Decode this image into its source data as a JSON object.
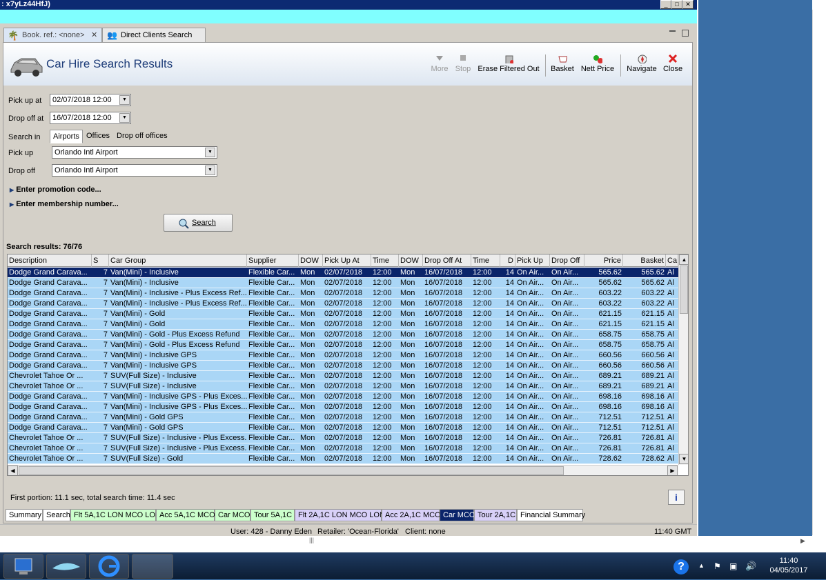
{
  "window": {
    "title": ": x7yLz44HfJ)"
  },
  "doc_tabs": [
    {
      "label": "Book. ref.: <none>"
    },
    {
      "label": "Direct Clients Search"
    }
  ],
  "header": {
    "title": "Car Hire Search Results"
  },
  "toolbar": {
    "more": "More",
    "stop": "Stop",
    "erase": "Erase Filtered Out",
    "basket": "Basket",
    "nett_price": "Nett Price",
    "navigate": "Navigate",
    "close": "Close"
  },
  "form": {
    "pickup_at_label": "Pick up at",
    "pickup_at_value": "02/07/2018 12:00",
    "dropoff_at_label": "Drop off at",
    "dropoff_at_value": "16/07/2018 12:00",
    "search_in_label": "Search in",
    "search_in_options": [
      "Airports",
      "Offices",
      "Drop off offices"
    ],
    "pickup_label": "Pick up",
    "pickup_value": "Orlando Intl Airport",
    "dropoff_label": "Drop off",
    "dropoff_value": "Orlando Intl Airport",
    "promo": "Enter promotion code...",
    "membership": "Enter membership number...",
    "search_button": "Search"
  },
  "results": {
    "label": "Search results: 76/76",
    "columns": [
      "Description",
      "S",
      "Car Group",
      "Supplier",
      "DOW",
      "Pick Up At",
      "Time",
      "DOW",
      "Drop Off At",
      "Time",
      "D",
      "Pick Up",
      "Drop Off",
      "Price",
      "Basket",
      "Ca"
    ],
    "rows": [
      [
        "Dodge Grand Carava...",
        "7",
        "Van(Mini) - Inclusive",
        "Flexible Car...",
        "Mon",
        "02/07/2018",
        "12:00",
        "Mon",
        "16/07/2018",
        "12:00",
        "14",
        "On Air...",
        "On Air...",
        "565.62",
        "565.62",
        "Al"
      ],
      [
        "Dodge Grand Carava...",
        "7",
        "Van(Mini) - Inclusive",
        "Flexible Car...",
        "Mon",
        "02/07/2018",
        "12:00",
        "Mon",
        "16/07/2018",
        "12:00",
        "14",
        "On Air...",
        "On Air...",
        "565.62",
        "565.62",
        "Al"
      ],
      [
        "Dodge Grand Carava...",
        "7",
        "Van(Mini) - Inclusive - Plus Excess Ref...",
        "Flexible Car...",
        "Mon",
        "02/07/2018",
        "12:00",
        "Mon",
        "16/07/2018",
        "12:00",
        "14",
        "On Air...",
        "On Air...",
        "603.22",
        "603.22",
        "Al"
      ],
      [
        "Dodge Grand Carava...",
        "7",
        "Van(Mini) - Inclusive - Plus Excess Ref...",
        "Flexible Car...",
        "Mon",
        "02/07/2018",
        "12:00",
        "Mon",
        "16/07/2018",
        "12:00",
        "14",
        "On Air...",
        "On Air...",
        "603.22",
        "603.22",
        "Al"
      ],
      [
        "Dodge Grand Carava...",
        "7",
        "Van(Mini) - Gold",
        "Flexible Car...",
        "Mon",
        "02/07/2018",
        "12:00",
        "Mon",
        "16/07/2018",
        "12:00",
        "14",
        "On Air...",
        "On Air...",
        "621.15",
        "621.15",
        "Al"
      ],
      [
        "Dodge Grand Carava...",
        "7",
        "Van(Mini) - Gold",
        "Flexible Car...",
        "Mon",
        "02/07/2018",
        "12:00",
        "Mon",
        "16/07/2018",
        "12:00",
        "14",
        "On Air...",
        "On Air...",
        "621.15",
        "621.15",
        "Al"
      ],
      [
        "Dodge Grand Carava...",
        "7",
        "Van(Mini) - Gold - Plus Excess Refund",
        "Flexible Car...",
        "Mon",
        "02/07/2018",
        "12:00",
        "Mon",
        "16/07/2018",
        "12:00",
        "14",
        "On Air...",
        "On Air...",
        "658.75",
        "658.75",
        "Al"
      ],
      [
        "Dodge Grand Carava...",
        "7",
        "Van(Mini) - Gold - Plus Excess Refund",
        "Flexible Car...",
        "Mon",
        "02/07/2018",
        "12:00",
        "Mon",
        "16/07/2018",
        "12:00",
        "14",
        "On Air...",
        "On Air...",
        "658.75",
        "658.75",
        "Al"
      ],
      [
        "Dodge Grand Carava...",
        "7",
        "Van(Mini) - Inclusive GPS",
        "Flexible Car...",
        "Mon",
        "02/07/2018",
        "12:00",
        "Mon",
        "16/07/2018",
        "12:00",
        "14",
        "On Air...",
        "On Air...",
        "660.56",
        "660.56",
        "Al"
      ],
      [
        "Dodge Grand Carava...",
        "7",
        "Van(Mini) - Inclusive GPS",
        "Flexible Car...",
        "Mon",
        "02/07/2018",
        "12:00",
        "Mon",
        "16/07/2018",
        "12:00",
        "14",
        "On Air...",
        "On Air...",
        "660.56",
        "660.56",
        "Al"
      ],
      [
        "Chevrolet Tahoe Or ...",
        "7",
        "SUV(Full Size) - Inclusive",
        "Flexible Car...",
        "Mon",
        "02/07/2018",
        "12:00",
        "Mon",
        "16/07/2018",
        "12:00",
        "14",
        "On Air...",
        "On Air...",
        "689.21",
        "689.21",
        "Al"
      ],
      [
        "Chevrolet Tahoe Or ...",
        "7",
        "SUV(Full Size) - Inclusive",
        "Flexible Car...",
        "Mon",
        "02/07/2018",
        "12:00",
        "Mon",
        "16/07/2018",
        "12:00",
        "14",
        "On Air...",
        "On Air...",
        "689.21",
        "689.21",
        "Al"
      ],
      [
        "Dodge Grand Carava...",
        "7",
        "Van(Mini) - Inclusive GPS - Plus Exces...",
        "Flexible Car...",
        "Mon",
        "02/07/2018",
        "12:00",
        "Mon",
        "16/07/2018",
        "12:00",
        "14",
        "On Air...",
        "On Air...",
        "698.16",
        "698.16",
        "Al"
      ],
      [
        "Dodge Grand Carava...",
        "7",
        "Van(Mini) - Inclusive GPS - Plus Exces...",
        "Flexible Car...",
        "Mon",
        "02/07/2018",
        "12:00",
        "Mon",
        "16/07/2018",
        "12:00",
        "14",
        "On Air...",
        "On Air...",
        "698.16",
        "698.16",
        "Al"
      ],
      [
        "Dodge Grand Carava...",
        "7",
        "Van(Mini) - Gold GPS",
        "Flexible Car...",
        "Mon",
        "02/07/2018",
        "12:00",
        "Mon",
        "16/07/2018",
        "12:00",
        "14",
        "On Air...",
        "On Air...",
        "712.51",
        "712.51",
        "Al"
      ],
      [
        "Dodge Grand Carava...",
        "7",
        "Van(Mini) - Gold GPS",
        "Flexible Car...",
        "Mon",
        "02/07/2018",
        "12:00",
        "Mon",
        "16/07/2018",
        "12:00",
        "14",
        "On Air...",
        "On Air...",
        "712.51",
        "712.51",
        "Al"
      ],
      [
        "Chevrolet Tahoe Or ...",
        "7",
        "SUV(Full Size) - Inclusive - Plus Excess...",
        "Flexible Car...",
        "Mon",
        "02/07/2018",
        "12:00",
        "Mon",
        "16/07/2018",
        "12:00",
        "14",
        "On Air...",
        "On Air...",
        "726.81",
        "726.81",
        "Al"
      ],
      [
        "Chevrolet Tahoe Or ...",
        "7",
        "SUV(Full Size) - Inclusive - Plus Excess...",
        "Flexible Car...",
        "Mon",
        "02/07/2018",
        "12:00",
        "Mon",
        "16/07/2018",
        "12:00",
        "14",
        "On Air...",
        "On Air...",
        "726.81",
        "726.81",
        "Al"
      ],
      [
        "Chevrolet Tahoe Or ...",
        "7",
        "SUV(Full Size) - Gold",
        "Flexible Car...",
        "Mon",
        "02/07/2018",
        "12:00",
        "Mon",
        "16/07/2018",
        "12:00",
        "14",
        "On Air...",
        "On Air...",
        "728.62",
        "728.62",
        "Al"
      ]
    ]
  },
  "timing": "First portion: 11.1 sec, total search time: 11.4 sec",
  "bottom_tabs": [
    {
      "label": "Summary",
      "color": "#ffffff"
    },
    {
      "label": "Search",
      "color": "#ffffff"
    },
    {
      "label": "Flt 5A,1C LON MCO LON",
      "color": "#ccffcc"
    },
    {
      "label": "Acc 5A,1C MCO",
      "color": "#ccffcc"
    },
    {
      "label": "Car MCO",
      "color": "#ccffcc"
    },
    {
      "label": "Tour 5A,1C",
      "color": "#ccffcc"
    },
    {
      "label": "Flt 2A,1C LON MCO LON",
      "color": "#d8d0f8"
    },
    {
      "label": "Acc 2A,1C MCO",
      "color": "#d8d0f8"
    },
    {
      "label": "Car MCO",
      "color": "#0a246a"
    },
    {
      "label": "Tour 2A,1C",
      "color": "#d8d0f8"
    },
    {
      "label": "Financial Summary",
      "color": "#ffffff"
    }
  ],
  "status": {
    "user": "User: 428 - Danny Eden",
    "retailer": "Retailer: 'Ocean-Florida'",
    "client": "Client: none",
    "time": "11:40 GMT"
  },
  "taskbar": {
    "time": "11:40",
    "date": "04/05/2017"
  }
}
